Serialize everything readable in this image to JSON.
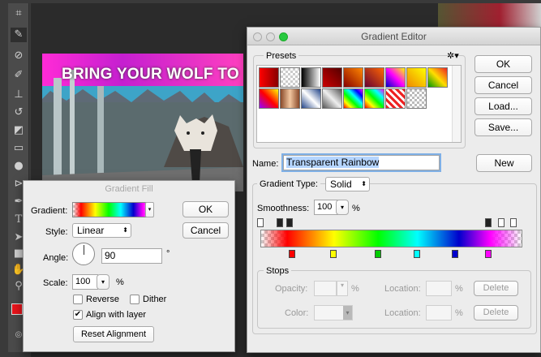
{
  "toolbar": {
    "tools": [
      "crop-icon",
      "eyedropper-icon",
      "spot-healing-icon",
      "brush-icon",
      "clone-stamp-icon",
      "history-brush-icon",
      "eraser-icon",
      "gradient-icon",
      "blur-icon",
      "dodge-icon",
      "pen-icon",
      "type-icon",
      "path-selection-icon",
      "rectangle-icon",
      "hand-icon",
      "zoom-icon"
    ],
    "type_glyph": "T",
    "foreground_color": "#e8141b"
  },
  "artwork": {
    "title": "BRING YOUR WOLF TO"
  },
  "gradient_editor": {
    "title": "Gradient Editor",
    "presets_label": "Presets",
    "ok": "OK",
    "cancel": "Cancel",
    "load": "Load...",
    "save": "Save...",
    "name_label": "Name:",
    "name_value": "Transparent Rainbow",
    "new": "New",
    "gradient_type_label": "Gradient Type:",
    "gradient_type_value": "Solid",
    "smoothness_label": "Smoothness:",
    "smoothness_value": "100",
    "percent": "%",
    "stops_label": "Stops",
    "opacity_label": "Opacity:",
    "color_label": "Color:",
    "location_label": "Location:",
    "delete": "Delete"
  },
  "gradient_fill": {
    "title": "Gradient Fill",
    "gradient_label": "Gradient:",
    "ok": "OK",
    "cancel": "Cancel",
    "style_label": "Style:",
    "style_value": "Linear",
    "angle_label": "Angle:",
    "angle_value": "90",
    "degree": "°",
    "scale_label": "Scale:",
    "scale_value": "100",
    "percent": "%",
    "reverse": "Reverse",
    "dither": "Dither",
    "align": "Align with layer",
    "reset": "Reset Alignment"
  }
}
